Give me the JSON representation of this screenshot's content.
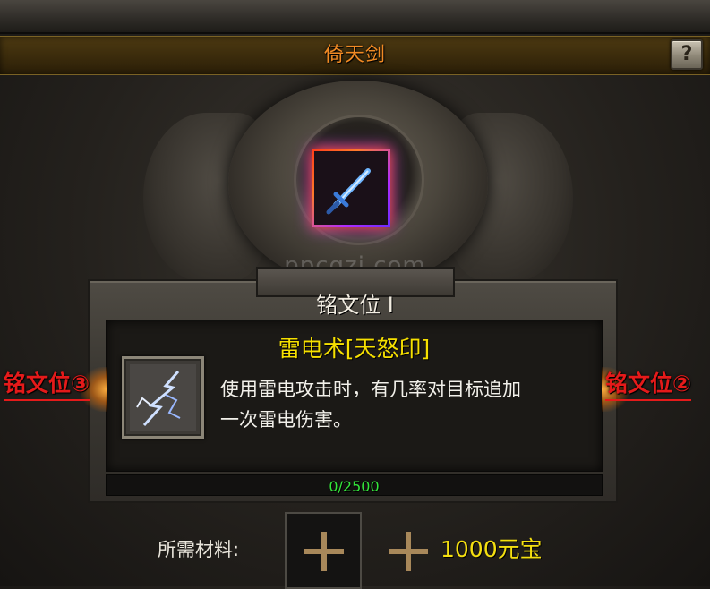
{
  "window": {
    "title": "倚天剑",
    "help_label": "?"
  },
  "watermark": "ppcqzi.com",
  "equipment": {
    "icon": "sword-icon"
  },
  "inscription": {
    "slot_label": "铭文位 I",
    "skill_name": "雷电术[天怒印]",
    "skill_icon": "lightning-icon",
    "description_line1": "使用雷电攻击时，有几率对目标追加",
    "description_line2": "一次雷电伤害。",
    "progress_text": "0/2500",
    "progress_fraction": 0
  },
  "side_slots": {
    "left": "铭文位③",
    "right": "铭文位②"
  },
  "materials": {
    "label": "所需材料:",
    "cost": "1000元宝"
  },
  "colors": {
    "title": "#f08a24",
    "skill_name": "#f6e000",
    "side_label": "#e51a1a",
    "progress": "#33e53a",
    "cost": "#f4df10"
  }
}
